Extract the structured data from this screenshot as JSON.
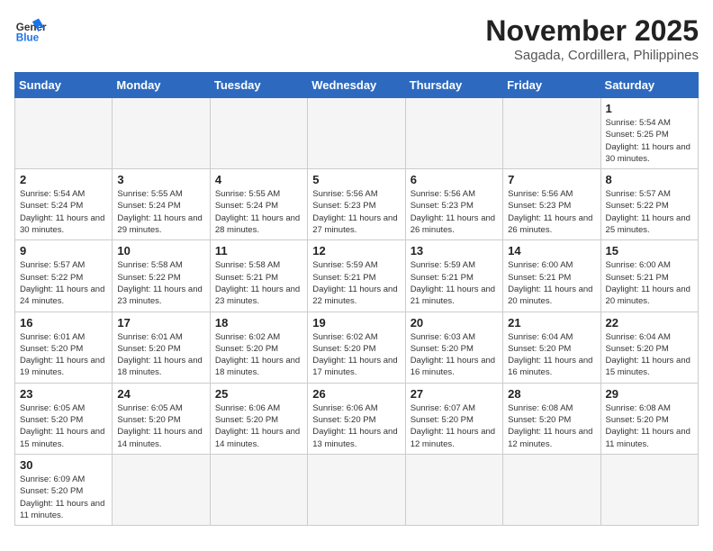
{
  "header": {
    "logo_general": "General",
    "logo_blue": "Blue",
    "month_title": "November 2025",
    "location": "Sagada, Cordillera, Philippines"
  },
  "weekdays": [
    "Sunday",
    "Monday",
    "Tuesday",
    "Wednesday",
    "Thursday",
    "Friday",
    "Saturday"
  ],
  "weeks": [
    [
      {
        "day": "",
        "info": ""
      },
      {
        "day": "",
        "info": ""
      },
      {
        "day": "",
        "info": ""
      },
      {
        "day": "",
        "info": ""
      },
      {
        "day": "",
        "info": ""
      },
      {
        "day": "",
        "info": ""
      },
      {
        "day": "1",
        "info": "Sunrise: 5:54 AM\nSunset: 5:25 PM\nDaylight: 11 hours and 30 minutes."
      }
    ],
    [
      {
        "day": "2",
        "info": "Sunrise: 5:54 AM\nSunset: 5:24 PM\nDaylight: 11 hours and 30 minutes."
      },
      {
        "day": "3",
        "info": "Sunrise: 5:55 AM\nSunset: 5:24 PM\nDaylight: 11 hours and 29 minutes."
      },
      {
        "day": "4",
        "info": "Sunrise: 5:55 AM\nSunset: 5:24 PM\nDaylight: 11 hours and 28 minutes."
      },
      {
        "day": "5",
        "info": "Sunrise: 5:56 AM\nSunset: 5:23 PM\nDaylight: 11 hours and 27 minutes."
      },
      {
        "day": "6",
        "info": "Sunrise: 5:56 AM\nSunset: 5:23 PM\nDaylight: 11 hours and 26 minutes."
      },
      {
        "day": "7",
        "info": "Sunrise: 5:56 AM\nSunset: 5:23 PM\nDaylight: 11 hours and 26 minutes."
      },
      {
        "day": "8",
        "info": "Sunrise: 5:57 AM\nSunset: 5:22 PM\nDaylight: 11 hours and 25 minutes."
      }
    ],
    [
      {
        "day": "9",
        "info": "Sunrise: 5:57 AM\nSunset: 5:22 PM\nDaylight: 11 hours and 24 minutes."
      },
      {
        "day": "10",
        "info": "Sunrise: 5:58 AM\nSunset: 5:22 PM\nDaylight: 11 hours and 23 minutes."
      },
      {
        "day": "11",
        "info": "Sunrise: 5:58 AM\nSunset: 5:21 PM\nDaylight: 11 hours and 23 minutes."
      },
      {
        "day": "12",
        "info": "Sunrise: 5:59 AM\nSunset: 5:21 PM\nDaylight: 11 hours and 22 minutes."
      },
      {
        "day": "13",
        "info": "Sunrise: 5:59 AM\nSunset: 5:21 PM\nDaylight: 11 hours and 21 minutes."
      },
      {
        "day": "14",
        "info": "Sunrise: 6:00 AM\nSunset: 5:21 PM\nDaylight: 11 hours and 20 minutes."
      },
      {
        "day": "15",
        "info": "Sunrise: 6:00 AM\nSunset: 5:21 PM\nDaylight: 11 hours and 20 minutes."
      }
    ],
    [
      {
        "day": "16",
        "info": "Sunrise: 6:01 AM\nSunset: 5:20 PM\nDaylight: 11 hours and 19 minutes."
      },
      {
        "day": "17",
        "info": "Sunrise: 6:01 AM\nSunset: 5:20 PM\nDaylight: 11 hours and 18 minutes."
      },
      {
        "day": "18",
        "info": "Sunrise: 6:02 AM\nSunset: 5:20 PM\nDaylight: 11 hours and 18 minutes."
      },
      {
        "day": "19",
        "info": "Sunrise: 6:02 AM\nSunset: 5:20 PM\nDaylight: 11 hours and 17 minutes."
      },
      {
        "day": "20",
        "info": "Sunrise: 6:03 AM\nSunset: 5:20 PM\nDaylight: 11 hours and 16 minutes."
      },
      {
        "day": "21",
        "info": "Sunrise: 6:04 AM\nSunset: 5:20 PM\nDaylight: 11 hours and 16 minutes."
      },
      {
        "day": "22",
        "info": "Sunrise: 6:04 AM\nSunset: 5:20 PM\nDaylight: 11 hours and 15 minutes."
      }
    ],
    [
      {
        "day": "23",
        "info": "Sunrise: 6:05 AM\nSunset: 5:20 PM\nDaylight: 11 hours and 15 minutes."
      },
      {
        "day": "24",
        "info": "Sunrise: 6:05 AM\nSunset: 5:20 PM\nDaylight: 11 hours and 14 minutes."
      },
      {
        "day": "25",
        "info": "Sunrise: 6:06 AM\nSunset: 5:20 PM\nDaylight: 11 hours and 14 minutes."
      },
      {
        "day": "26",
        "info": "Sunrise: 6:06 AM\nSunset: 5:20 PM\nDaylight: 11 hours and 13 minutes."
      },
      {
        "day": "27",
        "info": "Sunrise: 6:07 AM\nSunset: 5:20 PM\nDaylight: 11 hours and 12 minutes."
      },
      {
        "day": "28",
        "info": "Sunrise: 6:08 AM\nSunset: 5:20 PM\nDaylight: 11 hours and 12 minutes."
      },
      {
        "day": "29",
        "info": "Sunrise: 6:08 AM\nSunset: 5:20 PM\nDaylight: 11 hours and 11 minutes."
      }
    ],
    [
      {
        "day": "30",
        "info": "Sunrise: 6:09 AM\nSunset: 5:20 PM\nDaylight: 11 hours and 11 minutes."
      },
      {
        "day": "",
        "info": ""
      },
      {
        "day": "",
        "info": ""
      },
      {
        "day": "",
        "info": ""
      },
      {
        "day": "",
        "info": ""
      },
      {
        "day": "",
        "info": ""
      },
      {
        "day": "",
        "info": ""
      }
    ]
  ]
}
